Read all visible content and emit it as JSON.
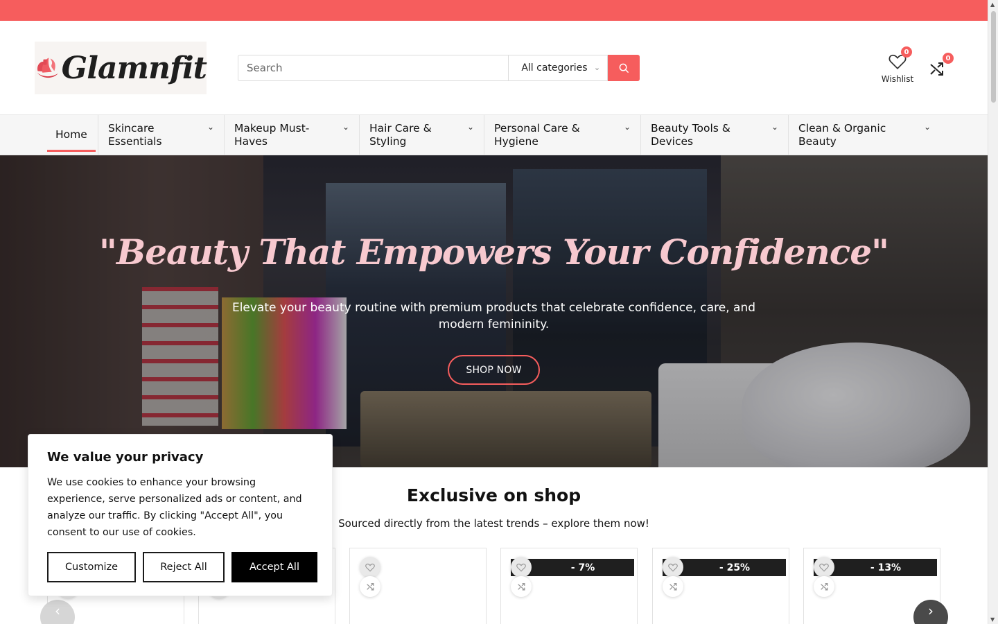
{
  "brand": {
    "name": "Glamnfit",
    "accent": "#f65d5d"
  },
  "search": {
    "placeholder": "Search",
    "category": "All categories"
  },
  "header": {
    "wishlist_label": "Wishlist",
    "wishlist_count": "0",
    "compare_count": "0"
  },
  "menu": {
    "items": [
      {
        "label": "Home"
      },
      {
        "label": "Skincare Essentials"
      },
      {
        "label": "Makeup Must-Haves"
      },
      {
        "label": "Hair Care & Styling"
      },
      {
        "label": "Personal Care & Hygiene"
      },
      {
        "label": "Beauty Tools & Devices"
      },
      {
        "label": "Clean & Organic Beauty"
      }
    ]
  },
  "hero": {
    "title": "\"Beauty That Empowers Your Confidence\"",
    "subtitle": "Elevate your beauty routine with premium products that celebrate confidence, care, and modern femininity.",
    "cta": "SHOP NOW"
  },
  "section": {
    "title": "Exclusive on shop",
    "subtitle": "Sourced directly from the latest trends – explore them now!"
  },
  "products": [
    {
      "discount": ""
    },
    {
      "discount": ""
    },
    {
      "discount": ""
    },
    {
      "discount": "- 7%"
    },
    {
      "discount": "- 25%"
    },
    {
      "discount": "- 13%"
    }
  ],
  "cookie": {
    "title": "We value your privacy",
    "text": "We use cookies to enhance your browsing experience, serve personalized ads or content, and analyze our traffic. By clicking \"Accept All\", you consent to our use of cookies.",
    "customize": "Customize",
    "reject": "Reject All",
    "accept": "Accept All"
  }
}
